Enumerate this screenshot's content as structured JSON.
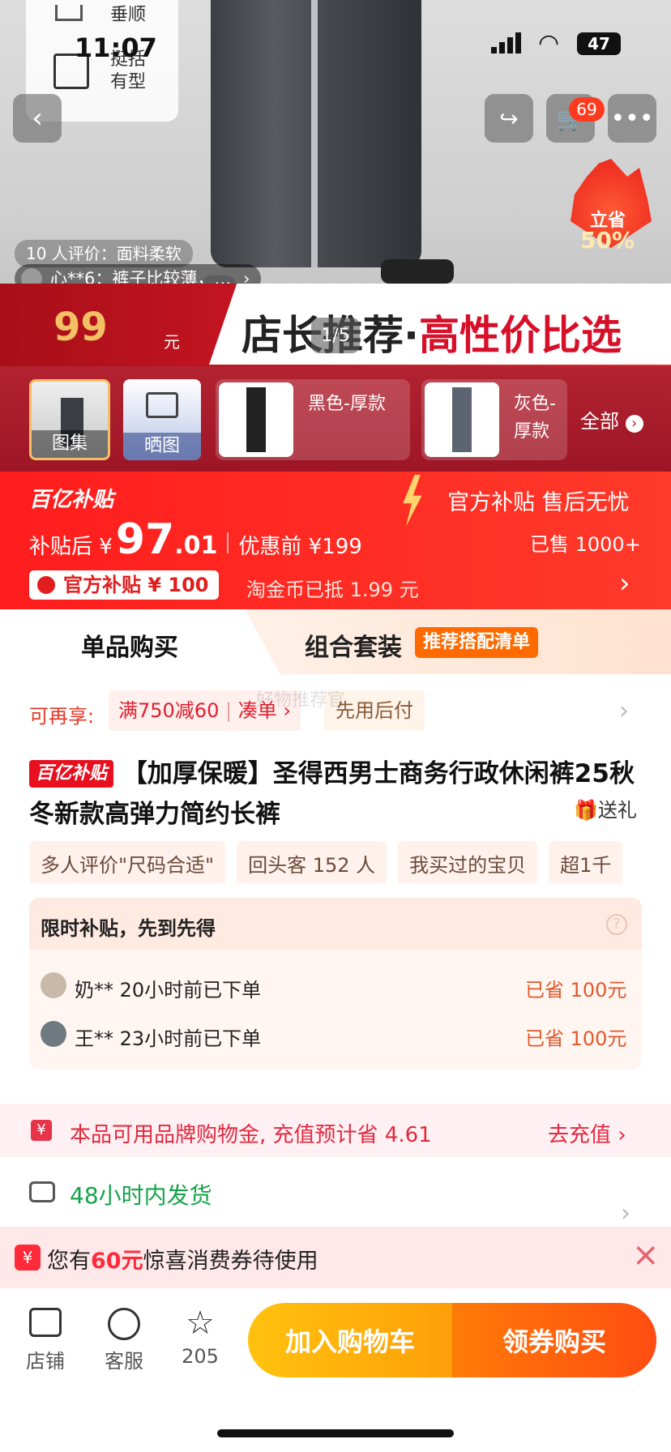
{
  "status_bar": {
    "time": "11:07",
    "battery": "47"
  },
  "hover_panel": {
    "item1": "垂顺",
    "item2_line1": "挺括",
    "item2_line2": "有型"
  },
  "hero": {
    "review_line1": "10 人评价：面料柔软",
    "review_line2": "心**6：裤子比较薄，…",
    "fire_badge_line1": "立省",
    "fire_badge_line2": "50%",
    "cart_count": "69",
    "image_counter": "1/5"
  },
  "price_band": {
    "price": "99",
    "unit": "元",
    "slogan_black": "店长推荐·",
    "slogan_red": "高性价比选"
  },
  "thumbs": {
    "gallery": "图集",
    "review_gallery": "晒图",
    "variant1": "黑色-厚款",
    "variant2": "灰色-厚款",
    "all": "全部"
  },
  "subsidy": {
    "brand": "百亿补贴",
    "after_label": "补贴后 ¥",
    "after_int": "97",
    "after_dec": ".01",
    "before_label": "优惠前 ¥199",
    "official": "官方补贴 售后无忧",
    "sold": "已售 1000+",
    "coupon": "官方补贴 ¥ 100",
    "taojin": "淘金币已抵 1.99 元"
  },
  "tabs": {
    "single": "单品购买",
    "combo": "组合套装",
    "combo_badge": "推荐搭配清单"
  },
  "promo": {
    "label": "可再享:",
    "deal": "满750减60",
    "deal_link": "凑单",
    "later": "先用后付",
    "watermark": "好物推荐官"
  },
  "title": {
    "badge": "百亿补贴",
    "text": "【加厚保暖】圣得西男士商务行政休闲裤25秋冬新款高弹力简约长裤",
    "gift": "送礼"
  },
  "tags": [
    "多人评价\"尺码合适\"",
    "回头客 152 人",
    "我买过的宝贝",
    "超1千"
  ],
  "limited": {
    "heading": "限时补贴，先到先得",
    "orders": [
      {
        "user": "奶** 20小时前已下单",
        "saved": "已省 100元"
      },
      {
        "user": "王** 23小时前已下单",
        "saved": "已省 100元"
      }
    ]
  },
  "brand_gold": {
    "text": "本品可用品牌购物金, 充值预计省 4.61",
    "action": "去充值"
  },
  "shipping": {
    "text": "48小时内发货"
  },
  "coupon_bar": {
    "prefix": "您有",
    "amount": "60元",
    "suffix": "惊喜消费券待使用"
  },
  "bottom": {
    "shop": "店铺",
    "service": "客服",
    "fav_count": "205",
    "add_cart": "加入购物车",
    "buy": "领券购买"
  },
  "colors": {
    "accent": "#ff2a1f",
    "gold": "#f3c066",
    "orange": "#ff7a00"
  }
}
